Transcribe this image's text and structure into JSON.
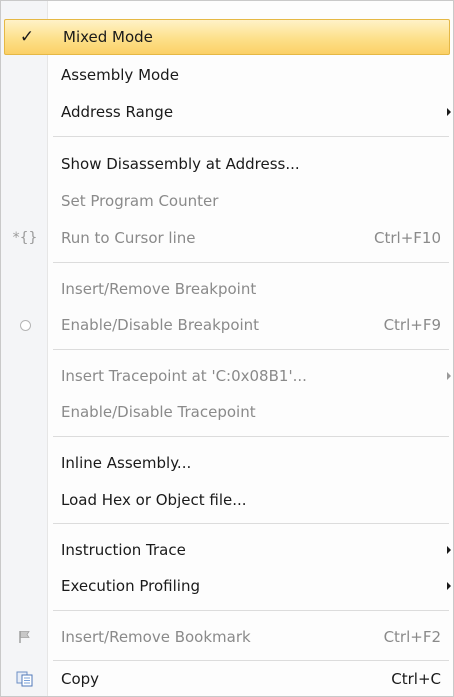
{
  "menu": {
    "items": [
      {
        "label": "Mixed Mode",
        "shortcut": "",
        "icon": "checkmark-icon",
        "enabled": true,
        "submenu": false,
        "highlighted": true
      },
      {
        "label": "Assembly Mode",
        "shortcut": "",
        "icon": "",
        "enabled": true,
        "submenu": false
      },
      {
        "label": "Address Range",
        "shortcut": "",
        "icon": "",
        "enabled": true,
        "submenu": true
      },
      {
        "label": "Show Disassembly at Address...",
        "shortcut": "",
        "icon": "",
        "enabled": true,
        "submenu": false
      },
      {
        "label": "Set Program Counter",
        "shortcut": "",
        "icon": "",
        "enabled": false,
        "submenu": false
      },
      {
        "label": "Run to Cursor line",
        "shortcut": "Ctrl+F10",
        "icon": "run-to-cursor-icon",
        "icon_glyph": "*{}",
        "enabled": false,
        "submenu": false
      },
      {
        "label": "Insert/Remove Breakpoint",
        "shortcut": "",
        "icon": "",
        "enabled": false,
        "submenu": false
      },
      {
        "label": "Enable/Disable Breakpoint",
        "shortcut": "Ctrl+F9",
        "icon": "breakpoint-circle-icon",
        "enabled": false,
        "submenu": false
      },
      {
        "label": "Insert Tracepoint at 'C:0x08B1'...",
        "shortcut": "",
        "icon": "",
        "enabled": false,
        "submenu": true
      },
      {
        "label": "Enable/Disable Tracepoint",
        "shortcut": "",
        "icon": "",
        "enabled": false,
        "submenu": false
      },
      {
        "label": "Inline Assembly...",
        "shortcut": "",
        "icon": "",
        "enabled": true,
        "submenu": false
      },
      {
        "label": "Load Hex or Object file...",
        "shortcut": "",
        "icon": "",
        "enabled": true,
        "submenu": false
      },
      {
        "label": "Instruction Trace",
        "shortcut": "",
        "icon": "",
        "enabled": true,
        "submenu": true
      },
      {
        "label": "Execution Profiling",
        "shortcut": "",
        "icon": "",
        "enabled": true,
        "submenu": true
      },
      {
        "label": "Insert/Remove Bookmark",
        "shortcut": "Ctrl+F2",
        "icon": "bookmark-flag-icon",
        "enabled": false,
        "submenu": false
      },
      {
        "label": "Copy",
        "shortcut": "Ctrl+C",
        "icon": "copy-icon",
        "enabled": true,
        "submenu": false
      }
    ]
  },
  "colors": {
    "highlight": "#fde08a",
    "highlight_border": "#e5b845",
    "text": "#1a1a1a",
    "disabled_text": "#8a8a8a"
  }
}
